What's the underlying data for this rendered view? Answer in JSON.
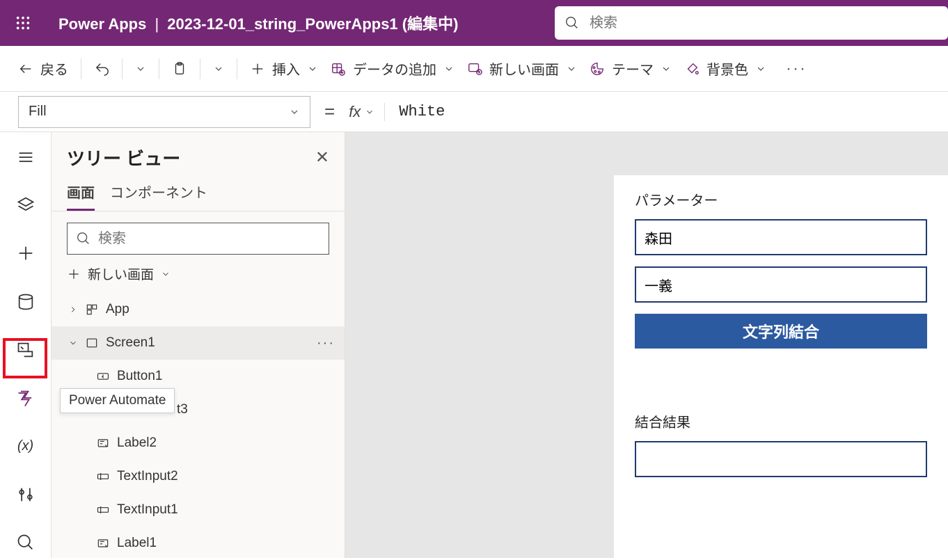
{
  "header": {
    "app_name": "Power Apps",
    "doc_title": "2023-12-01_string_PowerApps1 (編集中)",
    "search_placeholder": "検索"
  },
  "cmdbar": {
    "back": "戻る",
    "insert": "挿入",
    "add_data": "データの追加",
    "new_screen": "新しい画面",
    "theme": "テーマ",
    "bg_color": "背景色"
  },
  "formula": {
    "property": "Fill",
    "value": "White"
  },
  "rail": {
    "tooltip": "Power Automate",
    "var_label": "(x)"
  },
  "tree": {
    "title": "ツリー ビュー",
    "tabs": {
      "screens": "画面",
      "components": "コンポーネント"
    },
    "search_placeholder": "検索",
    "new_screen": "新しい画面",
    "items": [
      {
        "label": "App"
      },
      {
        "label": "Screen1"
      },
      {
        "label": "Button1"
      },
      {
        "label": "t3"
      },
      {
        "label": "Label2"
      },
      {
        "label": "TextInput2"
      },
      {
        "label": "TextInput1"
      },
      {
        "label": "Label1"
      }
    ]
  },
  "canvas": {
    "param_title": "パラメーター",
    "input1": "森田",
    "input2": "一義",
    "button": "文字列結合",
    "result_title": "結合結果",
    "result_value": ""
  }
}
